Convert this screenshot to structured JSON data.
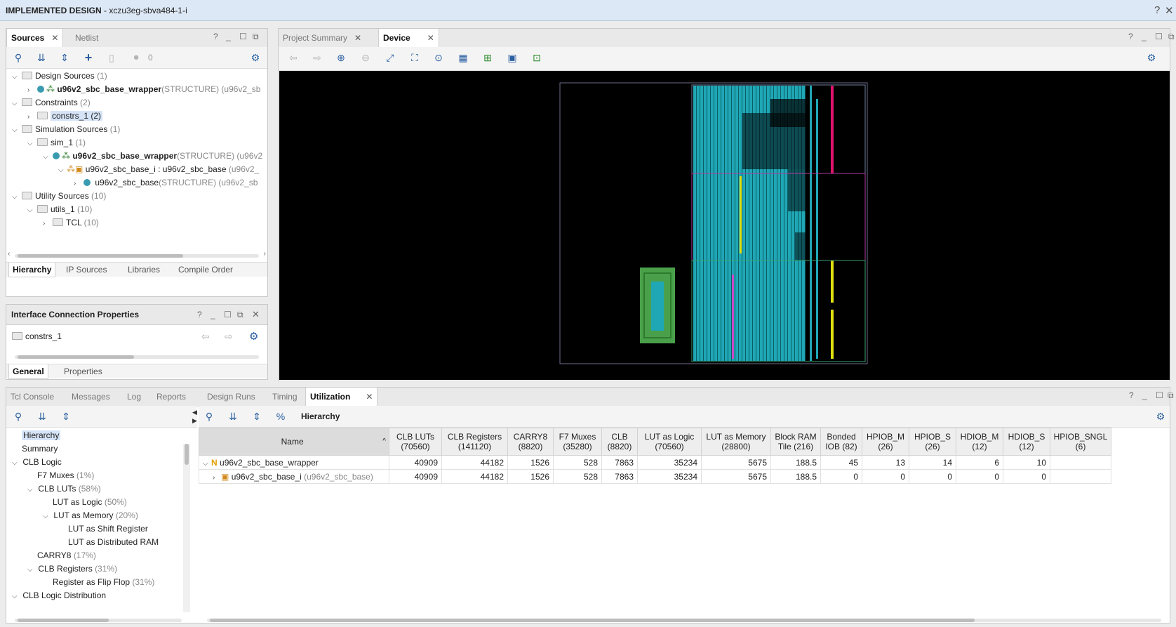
{
  "window": {
    "title_bold": "IMPLEMENTED DESIGN",
    "title_rest": " - xczu3eg-sbva484-1-i",
    "help": "?",
    "close": "✕"
  },
  "sources": {
    "tabs": [
      "Sources",
      "Netlist"
    ],
    "close": "✕",
    "count": "0",
    "tree": [
      {
        "label": "Design Sources",
        "count": "(1)"
      },
      {
        "label": "u96v2_sbc_base_wrapper",
        "suffix": "(STRUCTURE) (u96v2_sb"
      },
      {
        "label": "Constraints",
        "count": "(2)"
      },
      {
        "label": "constrs_1 (2)"
      },
      {
        "label": "Simulation Sources",
        "count": "(1)"
      },
      {
        "label": "sim_1",
        "count": "(1)"
      },
      {
        "label": "u96v2_sbc_base_wrapper",
        "suffix": "(STRUCTURE) (u96v2"
      },
      {
        "label": "u96v2_sbc_base_i : u96v2_sbc_base",
        "suffix": "(u96v2_"
      },
      {
        "label": "u96v2_sbc_base",
        "suffix": "(STRUCTURE) (u96v2_sb"
      },
      {
        "label": "Utility Sources",
        "count": "(10)"
      },
      {
        "label": "utils_1",
        "count": "(10)"
      },
      {
        "label": "TCL",
        "count": "(10)"
      }
    ],
    "bottom_tabs": [
      "Hierarchy",
      "IP Sources",
      "Libraries",
      "Compile Order"
    ]
  },
  "icp": {
    "title": "Interface Connection Properties",
    "item": "constrs_1",
    "bottom_tabs": [
      "General",
      "Properties"
    ]
  },
  "device": {
    "tabs": [
      "Project Summary",
      "Device"
    ],
    "close": "✕"
  },
  "bottom": {
    "tabs": [
      "Tcl Console",
      "Messages",
      "Log",
      "Reports",
      "Design Runs",
      "Timing",
      "Utilization"
    ],
    "close": "✕",
    "view_label": "Hierarchy",
    "left_tree": [
      {
        "label": "Hierarchy"
      },
      {
        "label": "Summary"
      },
      {
        "label": "CLB Logic"
      },
      {
        "label": "F7 Muxes",
        "pct": "(1%)"
      },
      {
        "label": "CLB LUTs",
        "pct": "(58%)"
      },
      {
        "label": "LUT as Logic",
        "pct": "(50%)"
      },
      {
        "label": "LUT as Memory",
        "pct": "(20%)"
      },
      {
        "label": "LUT as Shift Register"
      },
      {
        "label": "LUT as Distributed RAM"
      },
      {
        "label": "CARRY8",
        "pct": "(17%)"
      },
      {
        "label": "CLB Registers",
        "pct": "(31%)"
      },
      {
        "label": "Register as Flip Flop",
        "pct": "(31%)"
      },
      {
        "label": "CLB Logic Distribution"
      }
    ],
    "table": {
      "headers": [
        [
          "Name",
          ""
        ],
        [
          "CLB LUTs",
          "(70560)"
        ],
        [
          "CLB Registers",
          "(141120)"
        ],
        [
          "CARRY8",
          "(8820)"
        ],
        [
          "F7 Muxes",
          "(35280)"
        ],
        [
          "CLB",
          "(8820)"
        ],
        [
          "LUT as Logic",
          "(70560)"
        ],
        [
          "LUT as Memory",
          "(28800)"
        ],
        [
          "Block RAM",
          "Tile (216)"
        ],
        [
          "Bonded",
          "IOB (82)"
        ],
        [
          "HPIOB_M",
          "(26)"
        ],
        [
          "HPIOB_S",
          "(26)"
        ],
        [
          "HDIOB_M",
          "(12)"
        ],
        [
          "HDIOB_S",
          "(12)"
        ],
        [
          "HPIOB_SNGL",
          "(6)"
        ]
      ],
      "rows": [
        {
          "name": "u96v2_sbc_base_wrapper",
          "sub": "",
          "values": [
            "40909",
            "44182",
            "1526",
            "528",
            "7863",
            "35234",
            "5675",
            "188.5",
            "45",
            "13",
            "14",
            "6",
            "10",
            ""
          ]
        },
        {
          "name": "u96v2_sbc_base_i",
          "sub": "(u96v2_sbc_base)",
          "values": [
            "40909",
            "44182",
            "1526",
            "528",
            "7863",
            "35234",
            "5675",
            "188.5",
            "0",
            "0",
            "0",
            "0",
            "0",
            ""
          ]
        }
      ]
    }
  }
}
